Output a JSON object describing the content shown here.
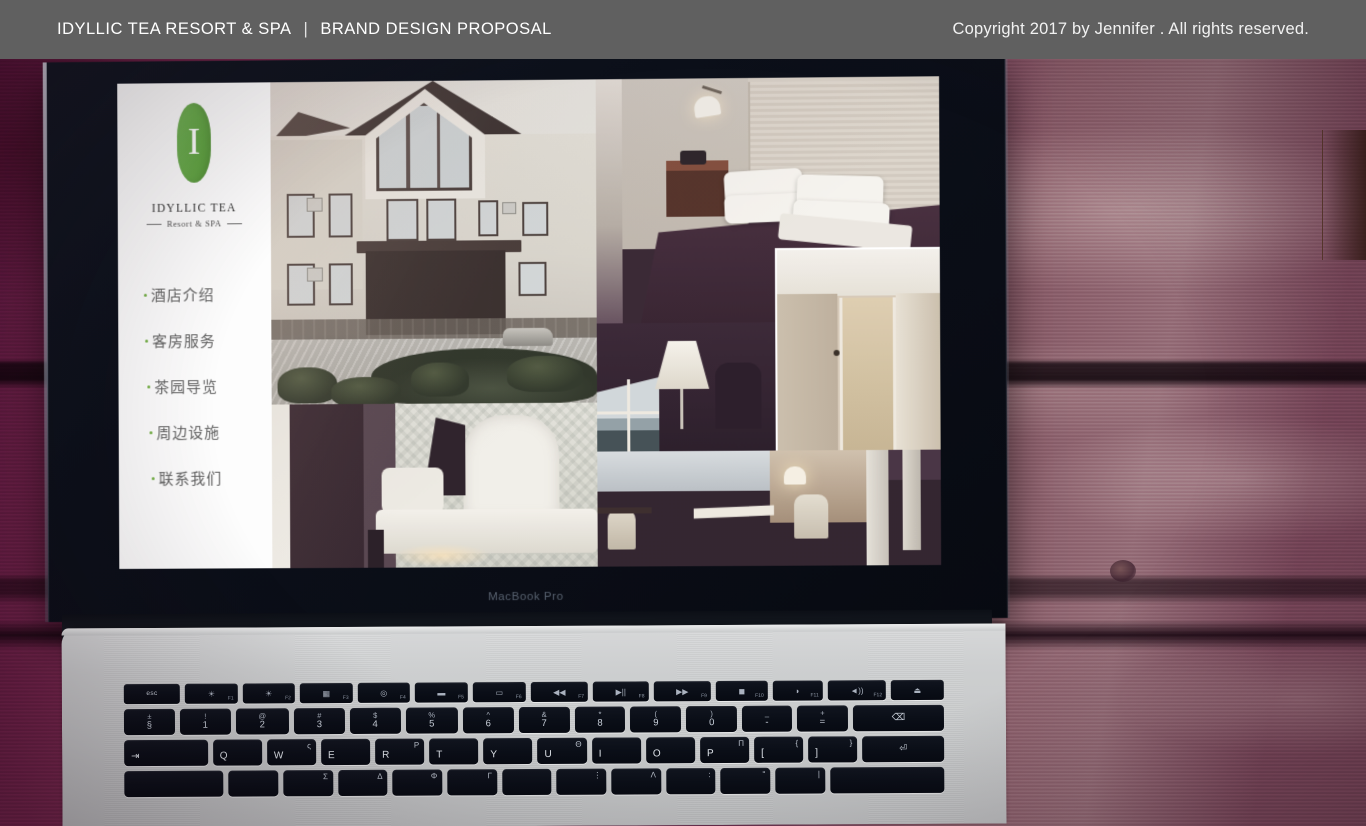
{
  "header": {
    "brand": "IDYLLIC TEA RESORT & SPA",
    "separator": "|",
    "section": "BRAND DESIGN PROPOSAL",
    "copyright": "Copyright 2017 by Jennifer . All rights reserved.",
    "background_color": "#606060",
    "text_color": "#ffffff"
  },
  "mockup": {
    "device_label": "MacBook Pro",
    "device_body_color": "#cfd1d2",
    "bezel_color": "#0a0d16",
    "background": "weathered purple wooden planks"
  },
  "website": {
    "logo": {
      "mark_letter": "I",
      "mark_shape": "leaf",
      "mark_color": "#5aa539",
      "name": "IDYLLIC TEA",
      "tagline": "Resort & SPA"
    },
    "nav": [
      {
        "label": "酒店介绍",
        "bullet": "·"
      },
      {
        "label": "客房服务",
        "bullet": "·"
      },
      {
        "label": "茶园导览",
        "bullet": "·"
      },
      {
        "label": "周边设施",
        "bullet": "·"
      },
      {
        "label": "联系我们",
        "bullet": "·"
      }
    ],
    "nav_text_color": "#5f5f5f",
    "nav_dot_color": "#6fae3e",
    "sidebar_background": "#fdfdfd",
    "gallery": [
      {
        "name": "hotel-exterior",
        "caption": "Hotel exterior with driveway and landscaping"
      },
      {
        "name": "guest-bedroom",
        "caption": "Guest bedroom with white pillows"
      },
      {
        "name": "corridor-doorway",
        "caption": "Corridor and guest room doorway"
      },
      {
        "name": "lounge-lamp",
        "caption": "Lounge with floor lamp and window"
      },
      {
        "name": "ornate-sofa",
        "caption": "Ornate carved sofa in sitting room"
      },
      {
        "name": "suite-interior",
        "caption": "Suite interior with desk and chairs"
      }
    ]
  },
  "keyboard": {
    "function_row": [
      {
        "label": "esc",
        "glyph": "",
        "fn": ""
      },
      {
        "label": "",
        "glyph": "☀",
        "fn": "F1"
      },
      {
        "label": "",
        "glyph": "☀",
        "fn": "F2"
      },
      {
        "label": "",
        "glyph": "▦",
        "fn": "F3"
      },
      {
        "label": "",
        "glyph": "◎",
        "fn": "F4"
      },
      {
        "label": "",
        "glyph": "▬",
        "fn": "F5"
      },
      {
        "label": "",
        "glyph": "▭",
        "fn": "F6"
      },
      {
        "label": "",
        "glyph": "◀◀",
        "fn": "F7"
      },
      {
        "label": "",
        "glyph": "▶||",
        "fn": "F8"
      },
      {
        "label": "",
        "glyph": "▶▶",
        "fn": "F9"
      },
      {
        "label": "",
        "glyph": "◼",
        "fn": "F10"
      },
      {
        "label": "",
        "glyph": "◗",
        "fn": "F11"
      },
      {
        "label": "",
        "glyph": "◄))",
        "fn": "F12"
      },
      {
        "label": "",
        "glyph": "⏏",
        "fn": ""
      }
    ],
    "number_row": [
      {
        "top": "±",
        "bottom": "§"
      },
      {
        "top": "!",
        "bottom": "1"
      },
      {
        "top": "@",
        "bottom": "2"
      },
      {
        "top": "#",
        "bottom": "3"
      },
      {
        "top": "$",
        "bottom": "4"
      },
      {
        "top": "%",
        "bottom": "5"
      },
      {
        "top": "^",
        "bottom": "6"
      },
      {
        "top": "&",
        "bottom": "7"
      },
      {
        "top": "*",
        "bottom": "8"
      },
      {
        "top": "(",
        "bottom": "9"
      },
      {
        "top": ")",
        "bottom": "0"
      },
      {
        "top": "_",
        "bottom": "-"
      },
      {
        "top": "+",
        "bottom": "="
      },
      {
        "top": "",
        "bottom": "⌫"
      }
    ],
    "qwerty_row": [
      {
        "latin": "⇥",
        "greek": ""
      },
      {
        "latin": "Q",
        "greek": ""
      },
      {
        "latin": "W",
        "greek": "ς"
      },
      {
        "latin": "E",
        "greek": ""
      },
      {
        "latin": "R",
        "greek": "Ρ"
      },
      {
        "latin": "T",
        "greek": ""
      },
      {
        "latin": "Y",
        "greek": ""
      },
      {
        "latin": "U",
        "greek": "Θ"
      },
      {
        "latin": "I",
        "greek": ""
      },
      {
        "latin": "O",
        "greek": ""
      },
      {
        "latin": "P",
        "greek": "Π"
      },
      {
        "latin": "[",
        "greek": "{"
      },
      {
        "latin": "]",
        "greek": "}"
      },
      {
        "latin": "⏎",
        "greek": ""
      }
    ],
    "home_row": [
      {
        "latin": "",
        "greek": ""
      },
      {
        "latin": "",
        "greek": ""
      },
      {
        "latin": "",
        "greek": "Σ"
      },
      {
        "latin": "",
        "greek": "Δ"
      },
      {
        "latin": "",
        "greek": "Φ"
      },
      {
        "latin": "",
        "greek": "Γ"
      },
      {
        "latin": "",
        "greek": ""
      },
      {
        "latin": "",
        "greek": "⋮"
      },
      {
        "latin": "",
        "greek": "Λ"
      },
      {
        "latin": "",
        "greek": ":"
      },
      {
        "latin": "",
        "greek": "\""
      },
      {
        "latin": "",
        "greek": "|"
      }
    ]
  }
}
